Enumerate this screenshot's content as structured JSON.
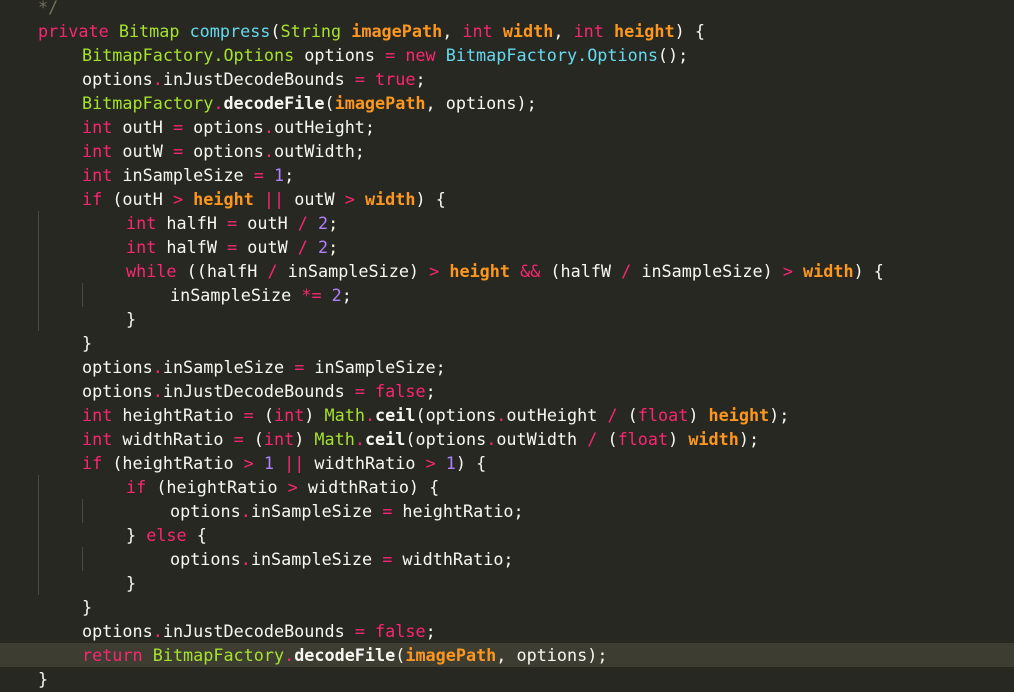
{
  "editor": {
    "theme": "monokai",
    "colors": {
      "background": "#272822",
      "current_line": "#3e3d32",
      "keyword": "#f92672",
      "storage_type": "#66d9ef",
      "class_name": "#a6e22e",
      "parameter": "#fd971f",
      "number": "#ae81ff",
      "comment": "#75715e",
      "text": "#f8f8f2"
    },
    "current_line_index": 27,
    "lines": [
      {
        "indent": 1,
        "tokens": [
          {
            "t": "*/",
            "c": "c"
          }
        ]
      },
      {
        "indent": 1,
        "tokens": [
          {
            "t": "private",
            "c": "k"
          },
          {
            "t": " "
          },
          {
            "t": "Bitmap",
            "c": "t"
          },
          {
            "t": " "
          },
          {
            "t": "compress",
            "c": "s"
          },
          {
            "t": "("
          },
          {
            "t": "String",
            "c": "t"
          },
          {
            "t": " "
          },
          {
            "t": "imagePath",
            "c": "p"
          },
          {
            "t": ", "
          },
          {
            "t": "int",
            "c": "k"
          },
          {
            "t": " "
          },
          {
            "t": "width",
            "c": "p"
          },
          {
            "t": ", "
          },
          {
            "t": "int",
            "c": "k"
          },
          {
            "t": " "
          },
          {
            "t": "height",
            "c": "p"
          },
          {
            "t": ") {"
          }
        ]
      },
      {
        "indent": 2,
        "tokens": [
          {
            "t": "BitmapFactory.Options",
            "c": "t"
          },
          {
            "t": " options "
          },
          {
            "t": "=",
            "c": "o"
          },
          {
            "t": " "
          },
          {
            "t": "new",
            "c": "k"
          },
          {
            "t": " "
          },
          {
            "t": "BitmapFactory.Options",
            "c": "s"
          },
          {
            "t": "();"
          }
        ]
      },
      {
        "indent": 2,
        "tokens": [
          {
            "t": "options"
          },
          {
            "t": ".",
            "c": "o"
          },
          {
            "t": "inJustDecodeBounds "
          },
          {
            "t": "=",
            "c": "o"
          },
          {
            "t": " "
          },
          {
            "t": "true",
            "c": "k"
          },
          {
            "t": ";"
          }
        ]
      },
      {
        "indent": 2,
        "tokens": [
          {
            "t": "BitmapFactory",
            "c": "t"
          },
          {
            "t": ".",
            "c": "o"
          },
          {
            "t": "decodeFile",
            "c": "m"
          },
          {
            "t": "("
          },
          {
            "t": "imagePath",
            "c": "p"
          },
          {
            "t": ", options);"
          }
        ]
      },
      {
        "indent": 2,
        "tokens": [
          {
            "t": "int",
            "c": "k"
          },
          {
            "t": " outH "
          },
          {
            "t": "=",
            "c": "o"
          },
          {
            "t": " options"
          },
          {
            "t": ".",
            "c": "o"
          },
          {
            "t": "outHeight;"
          }
        ]
      },
      {
        "indent": 2,
        "tokens": [
          {
            "t": "int",
            "c": "k"
          },
          {
            "t": " outW "
          },
          {
            "t": "=",
            "c": "o"
          },
          {
            "t": " options"
          },
          {
            "t": ".",
            "c": "o"
          },
          {
            "t": "outWidth;"
          }
        ]
      },
      {
        "indent": 2,
        "tokens": [
          {
            "t": "int",
            "c": "k"
          },
          {
            "t": " inSampleSize "
          },
          {
            "t": "=",
            "c": "o"
          },
          {
            "t": " "
          },
          {
            "t": "1",
            "c": "n"
          },
          {
            "t": ";"
          }
        ]
      },
      {
        "indent": 2,
        "tokens": [
          {
            "t": "if",
            "c": "k"
          },
          {
            "t": " (outH "
          },
          {
            "t": ">",
            "c": "o"
          },
          {
            "t": " "
          },
          {
            "t": "height",
            "c": "p"
          },
          {
            "t": " "
          },
          {
            "t": "||",
            "c": "o"
          },
          {
            "t": " outW "
          },
          {
            "t": ">",
            "c": "o"
          },
          {
            "t": " "
          },
          {
            "t": "width",
            "c": "p"
          },
          {
            "t": ") {"
          }
        ]
      },
      {
        "indent": 3,
        "tokens": [
          {
            "t": "int",
            "c": "k"
          },
          {
            "t": " halfH "
          },
          {
            "t": "=",
            "c": "o"
          },
          {
            "t": " outH "
          },
          {
            "t": "/",
            "c": "o"
          },
          {
            "t": " "
          },
          {
            "t": "2",
            "c": "n"
          },
          {
            "t": ";"
          }
        ]
      },
      {
        "indent": 3,
        "tokens": [
          {
            "t": "int",
            "c": "k"
          },
          {
            "t": " halfW "
          },
          {
            "t": "=",
            "c": "o"
          },
          {
            "t": " outW "
          },
          {
            "t": "/",
            "c": "o"
          },
          {
            "t": " "
          },
          {
            "t": "2",
            "c": "n"
          },
          {
            "t": ";"
          }
        ]
      },
      {
        "indent": 3,
        "tokens": [
          {
            "t": "while",
            "c": "k"
          },
          {
            "t": " ((halfH "
          },
          {
            "t": "/",
            "c": "o"
          },
          {
            "t": " inSampleSize) "
          },
          {
            "t": ">",
            "c": "o"
          },
          {
            "t": " "
          },
          {
            "t": "height",
            "c": "p"
          },
          {
            "t": " "
          },
          {
            "t": "&&",
            "c": "o"
          },
          {
            "t": " (halfW "
          },
          {
            "t": "/",
            "c": "o"
          },
          {
            "t": " inSampleSize) "
          },
          {
            "t": ">",
            "c": "o"
          },
          {
            "t": " "
          },
          {
            "t": "width",
            "c": "p"
          },
          {
            "t": ") {"
          }
        ]
      },
      {
        "indent": 4,
        "tokens": [
          {
            "t": "inSampleSize "
          },
          {
            "t": "*=",
            "c": "o"
          },
          {
            "t": " "
          },
          {
            "t": "2",
            "c": "n"
          },
          {
            "t": ";"
          }
        ]
      },
      {
        "indent": 3,
        "tokens": [
          {
            "t": "}"
          }
        ]
      },
      {
        "indent": 2,
        "tokens": [
          {
            "t": "}"
          }
        ]
      },
      {
        "indent": 2,
        "tokens": [
          {
            "t": "options"
          },
          {
            "t": ".",
            "c": "o"
          },
          {
            "t": "inSampleSize "
          },
          {
            "t": "=",
            "c": "o"
          },
          {
            "t": " inSampleSize;"
          }
        ]
      },
      {
        "indent": 2,
        "tokens": [
          {
            "t": "options"
          },
          {
            "t": ".",
            "c": "o"
          },
          {
            "t": "inJustDecodeBounds "
          },
          {
            "t": "=",
            "c": "o"
          },
          {
            "t": " "
          },
          {
            "t": "false",
            "c": "k"
          },
          {
            "t": ";"
          }
        ]
      },
      {
        "indent": 2,
        "tokens": [
          {
            "t": "int",
            "c": "k"
          },
          {
            "t": " heightRatio "
          },
          {
            "t": "=",
            "c": "o"
          },
          {
            "t": " ("
          },
          {
            "t": "int",
            "c": "k"
          },
          {
            "t": ") "
          },
          {
            "t": "Math",
            "c": "t"
          },
          {
            "t": ".",
            "c": "o"
          },
          {
            "t": "ceil",
            "c": "m"
          },
          {
            "t": "(options"
          },
          {
            "t": ".",
            "c": "o"
          },
          {
            "t": "outHeight "
          },
          {
            "t": "/",
            "c": "o"
          },
          {
            "t": " ("
          },
          {
            "t": "float",
            "c": "k"
          },
          {
            "t": ") "
          },
          {
            "t": "height",
            "c": "p"
          },
          {
            "t": ");"
          }
        ]
      },
      {
        "indent": 2,
        "tokens": [
          {
            "t": "int",
            "c": "k"
          },
          {
            "t": " widthRatio "
          },
          {
            "t": "=",
            "c": "o"
          },
          {
            "t": " ("
          },
          {
            "t": "int",
            "c": "k"
          },
          {
            "t": ") "
          },
          {
            "t": "Math",
            "c": "t"
          },
          {
            "t": ".",
            "c": "o"
          },
          {
            "t": "ceil",
            "c": "m"
          },
          {
            "t": "(options"
          },
          {
            "t": ".",
            "c": "o"
          },
          {
            "t": "outWidth "
          },
          {
            "t": "/",
            "c": "o"
          },
          {
            "t": " ("
          },
          {
            "t": "float",
            "c": "k"
          },
          {
            "t": ") "
          },
          {
            "t": "width",
            "c": "p"
          },
          {
            "t": ");"
          }
        ]
      },
      {
        "indent": 2,
        "tokens": [
          {
            "t": "if",
            "c": "k"
          },
          {
            "t": " (heightRatio "
          },
          {
            "t": ">",
            "c": "o"
          },
          {
            "t": " "
          },
          {
            "t": "1",
            "c": "n"
          },
          {
            "t": " "
          },
          {
            "t": "||",
            "c": "o"
          },
          {
            "t": " widthRatio "
          },
          {
            "t": ">",
            "c": "o"
          },
          {
            "t": " "
          },
          {
            "t": "1",
            "c": "n"
          },
          {
            "t": ") {"
          }
        ]
      },
      {
        "indent": 3,
        "tokens": [
          {
            "t": "if",
            "c": "k"
          },
          {
            "t": " (heightRatio "
          },
          {
            "t": ">",
            "c": "o"
          },
          {
            "t": " widthRatio) {"
          }
        ]
      },
      {
        "indent": 4,
        "tokens": [
          {
            "t": "options"
          },
          {
            "t": ".",
            "c": "o"
          },
          {
            "t": "inSampleSize "
          },
          {
            "t": "=",
            "c": "o"
          },
          {
            "t": " heightRatio;"
          }
        ]
      },
      {
        "indent": 3,
        "tokens": [
          {
            "t": "} "
          },
          {
            "t": "else",
            "c": "k"
          },
          {
            "t": " {"
          }
        ]
      },
      {
        "indent": 4,
        "tokens": [
          {
            "t": "options"
          },
          {
            "t": ".",
            "c": "o"
          },
          {
            "t": "inSampleSize "
          },
          {
            "t": "=",
            "c": "o"
          },
          {
            "t": " widthRatio;"
          }
        ]
      },
      {
        "indent": 3,
        "tokens": [
          {
            "t": "}"
          }
        ]
      },
      {
        "indent": 2,
        "tokens": [
          {
            "t": "}"
          }
        ]
      },
      {
        "indent": 2,
        "tokens": [
          {
            "t": "options"
          },
          {
            "t": ".",
            "c": "o"
          },
          {
            "t": "inJustDecodeBounds "
          },
          {
            "t": "=",
            "c": "o"
          },
          {
            "t": " "
          },
          {
            "t": "false",
            "c": "k"
          },
          {
            "t": ";"
          }
        ]
      },
      {
        "indent": 2,
        "tokens": [
          {
            "t": "return",
            "c": "k"
          },
          {
            "t": " "
          },
          {
            "t": "BitmapFactory",
            "c": "t"
          },
          {
            "t": ".",
            "c": "o"
          },
          {
            "t": "decodeFile",
            "c": "m"
          },
          {
            "t": "("
          },
          {
            "t": "imagePath",
            "c": "p"
          },
          {
            "t": ", options);"
          }
        ]
      },
      {
        "indent": 1,
        "tokens": [
          {
            "t": "}"
          }
        ]
      }
    ]
  }
}
